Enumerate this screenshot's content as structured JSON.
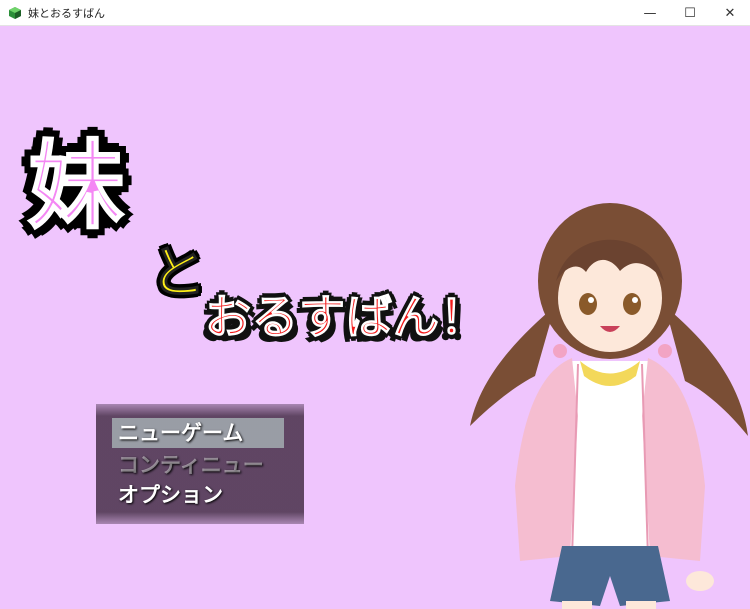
{
  "window": {
    "title": "妹とおるすばん",
    "minimize": "—",
    "maximize": "☐",
    "close": "✕"
  },
  "logo": {
    "imo": "妹",
    "to": "と",
    "rest": "おるすばん！"
  },
  "menu": {
    "items": [
      {
        "label": "ニューゲーム",
        "state": "selected"
      },
      {
        "label": "コンティニュー",
        "state": "disabled"
      },
      {
        "label": "オプション",
        "state": "normal"
      }
    ]
  },
  "colors": {
    "background": "#efc5fd",
    "logo_imo": "#f487f4",
    "logo_to": "#ffef17",
    "logo_rest": "#f21a1a"
  }
}
